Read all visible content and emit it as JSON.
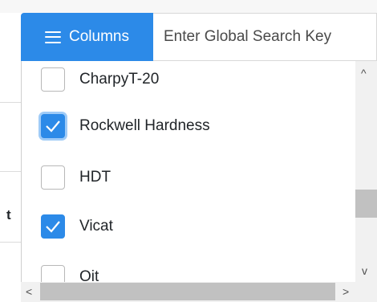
{
  "toolbar": {
    "columns_label": "Columns",
    "columns_icon": "hamburger-menu-icon",
    "search_placeholder": "Enter Global Search Key"
  },
  "background": {
    "partial_header_text": "t"
  },
  "columns_menu": {
    "items": [
      {
        "label": "CharpyT-20",
        "checked": false
      },
      {
        "label": "Rockwell Hardness",
        "checked": true,
        "focused": true
      },
      {
        "label": "HDT",
        "checked": false
      },
      {
        "label": "Vicat",
        "checked": true
      },
      {
        "label": "Oit",
        "checked": false
      }
    ]
  },
  "scrollbars": {
    "up_arrow": "^",
    "down_arrow": "v",
    "left_arrow": "<",
    "right_arrow": ">"
  },
  "colors": {
    "accent": "#2c8ae8",
    "focus_ring": "#9fcbf7"
  }
}
